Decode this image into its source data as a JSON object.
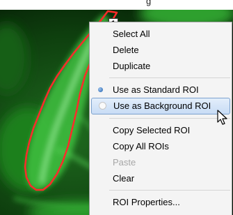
{
  "top_text": "g",
  "roi": {
    "label": "1"
  },
  "context_menu": {
    "items": [
      {
        "label": "Select All",
        "state": "normal"
      },
      {
        "label": "Delete",
        "state": "normal"
      },
      {
        "label": "Duplicate",
        "state": "normal"
      },
      {
        "label": "Use as Standard ROI",
        "state": "checked"
      },
      {
        "label": "Use as Background ROI",
        "state": "highlighted"
      },
      {
        "label": "Copy Selected ROI",
        "state": "normal"
      },
      {
        "label": "Copy All ROIs",
        "state": "normal"
      },
      {
        "label": "Paste",
        "state": "disabled"
      },
      {
        "label": "Clear",
        "state": "normal"
      },
      {
        "label": "ROI Properties...",
        "state": "normal"
      }
    ]
  },
  "icons": {
    "cursor": "mouse-pointer-icon"
  },
  "colors": {
    "roi_outline": "#ff2a2a",
    "fluorescence": "#3cd03c",
    "menu_highlight_border": "#7da2ce",
    "radio_checked": "#1d5fae"
  }
}
